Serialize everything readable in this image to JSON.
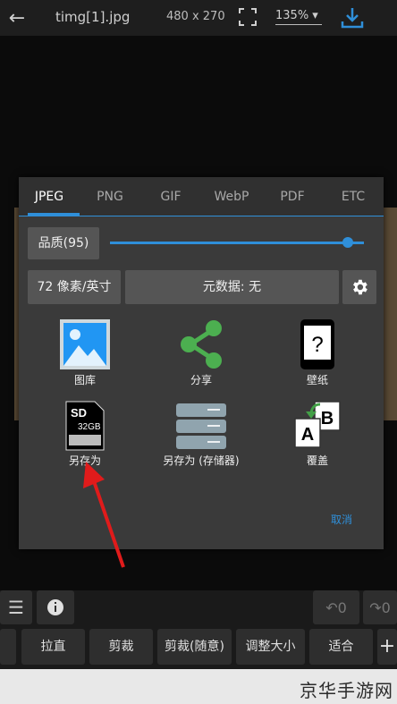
{
  "toolbar": {
    "filename": "timg[1].jpg",
    "dimensions": "480 x 270",
    "zoom": "135%"
  },
  "dialog": {
    "tabs": [
      "JPEG",
      "PNG",
      "GIF",
      "WebP",
      "PDF",
      "ETC"
    ],
    "quality_label": "品质(95)",
    "quality_value": 95,
    "dpi_label": "72 像素/英寸",
    "metadata_label": "元数据: 无",
    "actions": {
      "gallery": "图库",
      "share": "分享",
      "wallpaper": "壁纸",
      "save_as": "另存为",
      "save_as_storage": "另存为 (存储器)",
      "overwrite": "覆盖"
    },
    "cancel": "取消"
  },
  "bottom": {
    "undo_count": "0",
    "redo_count": "0",
    "tools": [
      "拉直",
      "剪裁",
      "剪裁(随意)",
      "调整大小",
      "适合"
    ]
  },
  "watermark": "京华手游网",
  "colors": {
    "accent": "#2f8fd9"
  }
}
